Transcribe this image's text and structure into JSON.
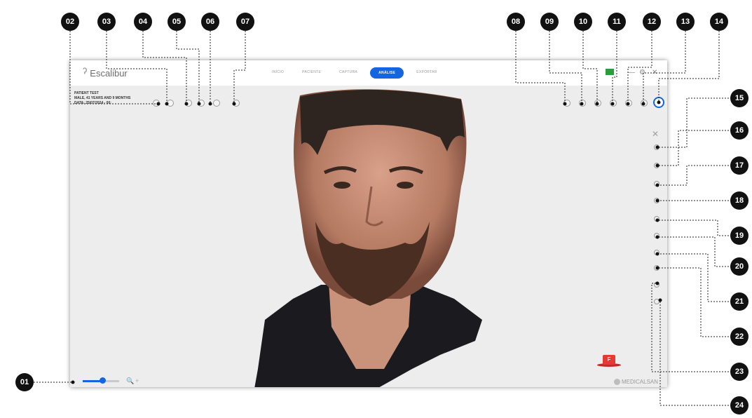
{
  "app": {
    "name": "Escalibur"
  },
  "tabs": [
    {
      "label": "INÍCIO",
      "active": false
    },
    {
      "label": "PACIENTE",
      "active": false
    },
    {
      "label": "CAPTURA",
      "active": false
    },
    {
      "label": "ANÁLISE",
      "active": true
    },
    {
      "label": "EXPORTAR",
      "active": false
    }
  ],
  "patient": {
    "name": "PATIENT TEST",
    "details": "MALE, 41 YEARS AND 9 MONTHS",
    "date": "DATA: 25/07/2024 - 00:"
  },
  "window_controls": {
    "minimize": "—",
    "maximize": "⚙",
    "close": "✕"
  },
  "view_badge": "F",
  "brand": "MEDICALSAN",
  "zoom": {
    "minus": "🔍",
    "plus": "+"
  },
  "colors": {
    "accent": "#1565e0",
    "marker": "#111111",
    "badge": "#e53935",
    "status_green": "#2e9c3a"
  },
  "markers": [
    "01",
    "02",
    "03",
    "04",
    "05",
    "06",
    "07",
    "08",
    "09",
    "10",
    "11",
    "12",
    "13",
    "14",
    "15",
    "16",
    "17",
    "18",
    "19",
    "20",
    "21",
    "22",
    "23",
    "24"
  ]
}
